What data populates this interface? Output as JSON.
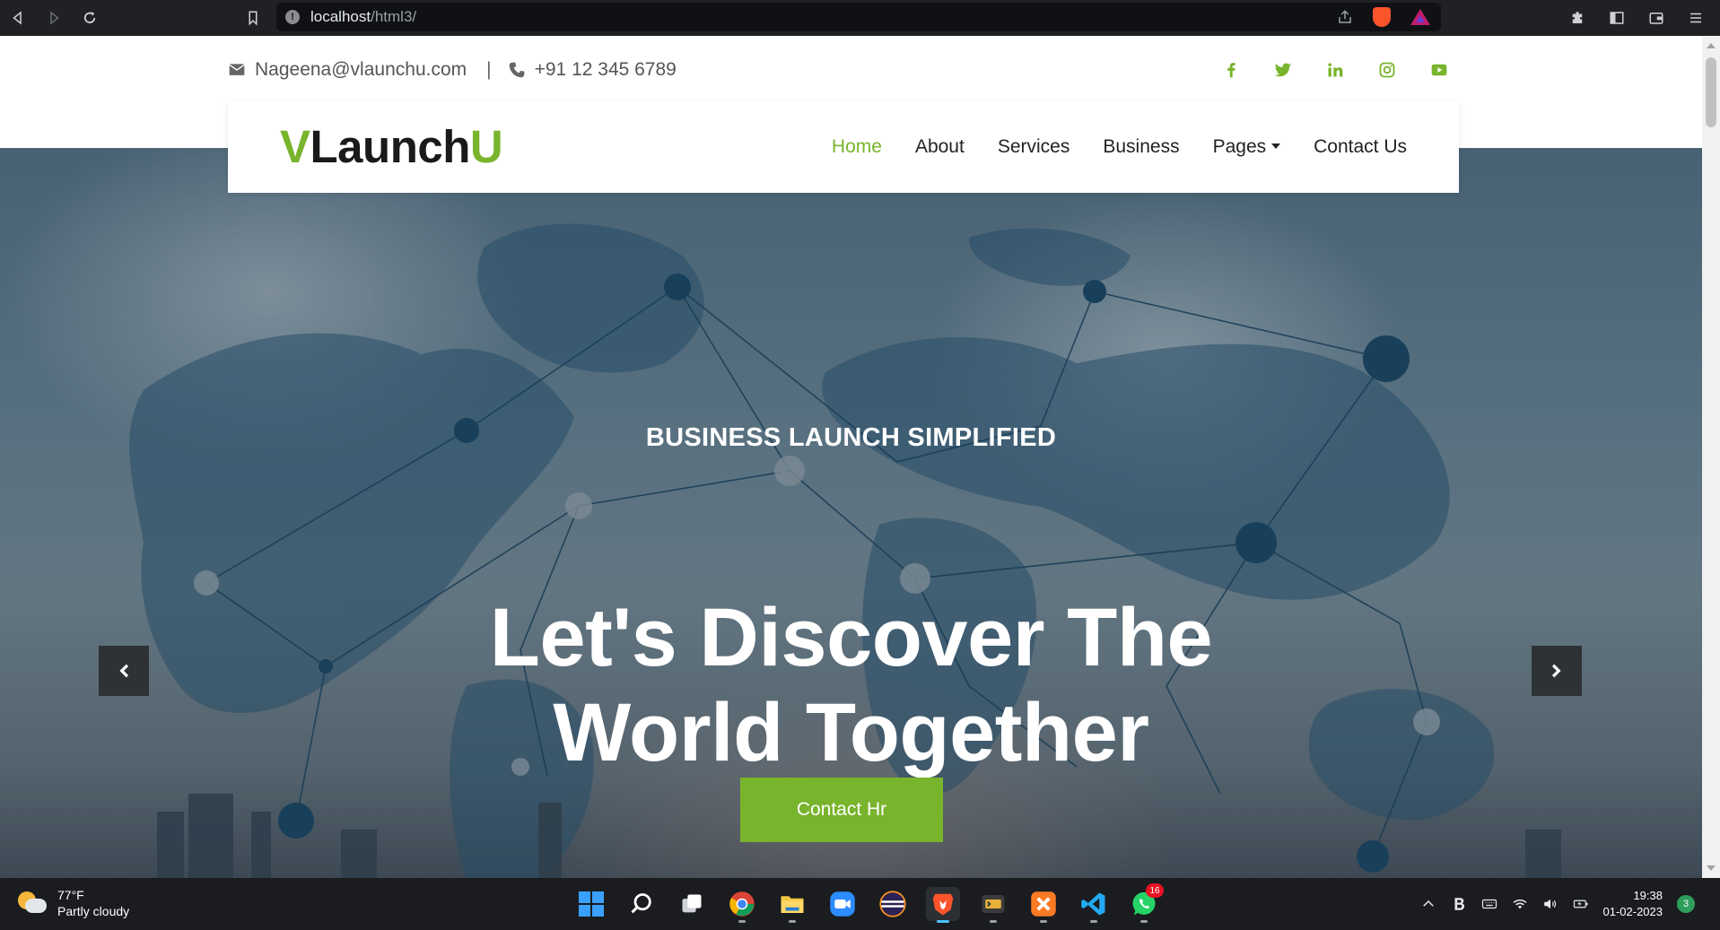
{
  "browser": {
    "url_host": "localhost",
    "url_path": "/html3/"
  },
  "topbar": {
    "email": "Nageena@vlaunchu.com",
    "separator": "|",
    "phone": "+91 12 345 6789",
    "social": [
      "facebook-icon",
      "twitter-icon",
      "linkedin-icon",
      "instagram-icon",
      "youtube-icon"
    ]
  },
  "navbar": {
    "logo_first": "V",
    "logo_mid": "Launch",
    "logo_last": "U",
    "menu": [
      "Home",
      "About",
      "Services",
      "Business",
      "Pages",
      "Contact Us"
    ],
    "active_item": "Home"
  },
  "hero": {
    "subtitle": "BUSINESS LAUNCH SIMPLIFIED",
    "title_line1": "Let's Discover The",
    "title_line2": "World Together",
    "button": "Contact Hr"
  },
  "taskbar": {
    "temperature": "77°F",
    "weather": "Partly cloudy",
    "whatsapp_badge": "16",
    "time": "19:38",
    "date": "01-02-2023",
    "notifications": "3"
  },
  "colors": {
    "brand_green": "#79b42d",
    "dark_text": "#1a1a1a",
    "chrome_bg": "#202124",
    "taskbar_bg": "#1a1c1f"
  }
}
